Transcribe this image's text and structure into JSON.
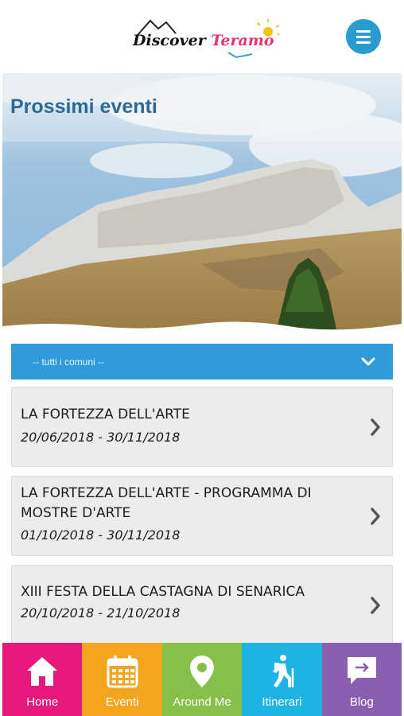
{
  "header": {
    "logo_part1": "Discover",
    "logo_part2": "Teramo",
    "menu_icon": "hamburger-menu-icon"
  },
  "hero": {
    "title": "Prossimi eventi"
  },
  "filter": {
    "selected": "-- tutti i comuni --",
    "icon": "chevron-down-icon"
  },
  "events": [
    {
      "title": "LA FORTEZZA DELL'ARTE",
      "dates": "20/06/2018 - 30/11/2018"
    },
    {
      "title": "LA FORTEZZA DELL'ARTE - PROGRAMMA DI MOSTRE D'ARTE",
      "dates": "01/10/2018 - 30/11/2018"
    },
    {
      "title": "XIII FESTA DELLA CASTAGNA DI SENARICA",
      "dates": "20/10/2018 - 21/10/2018"
    }
  ],
  "nav": [
    {
      "label": "Home",
      "icon": "home-icon",
      "color": "#e8197d"
    },
    {
      "label": "Eventi",
      "icon": "calendar-icon",
      "color": "#f2a51d"
    },
    {
      "label": "Around Me",
      "icon": "location-pin-icon",
      "color": "#86c04b"
    },
    {
      "label": "Itinerari",
      "icon": "hiker-icon",
      "color": "#1fb3e3"
    },
    {
      "label": "Blog",
      "icon": "speech-bubble-icon",
      "color": "#8b5fb0"
    }
  ]
}
